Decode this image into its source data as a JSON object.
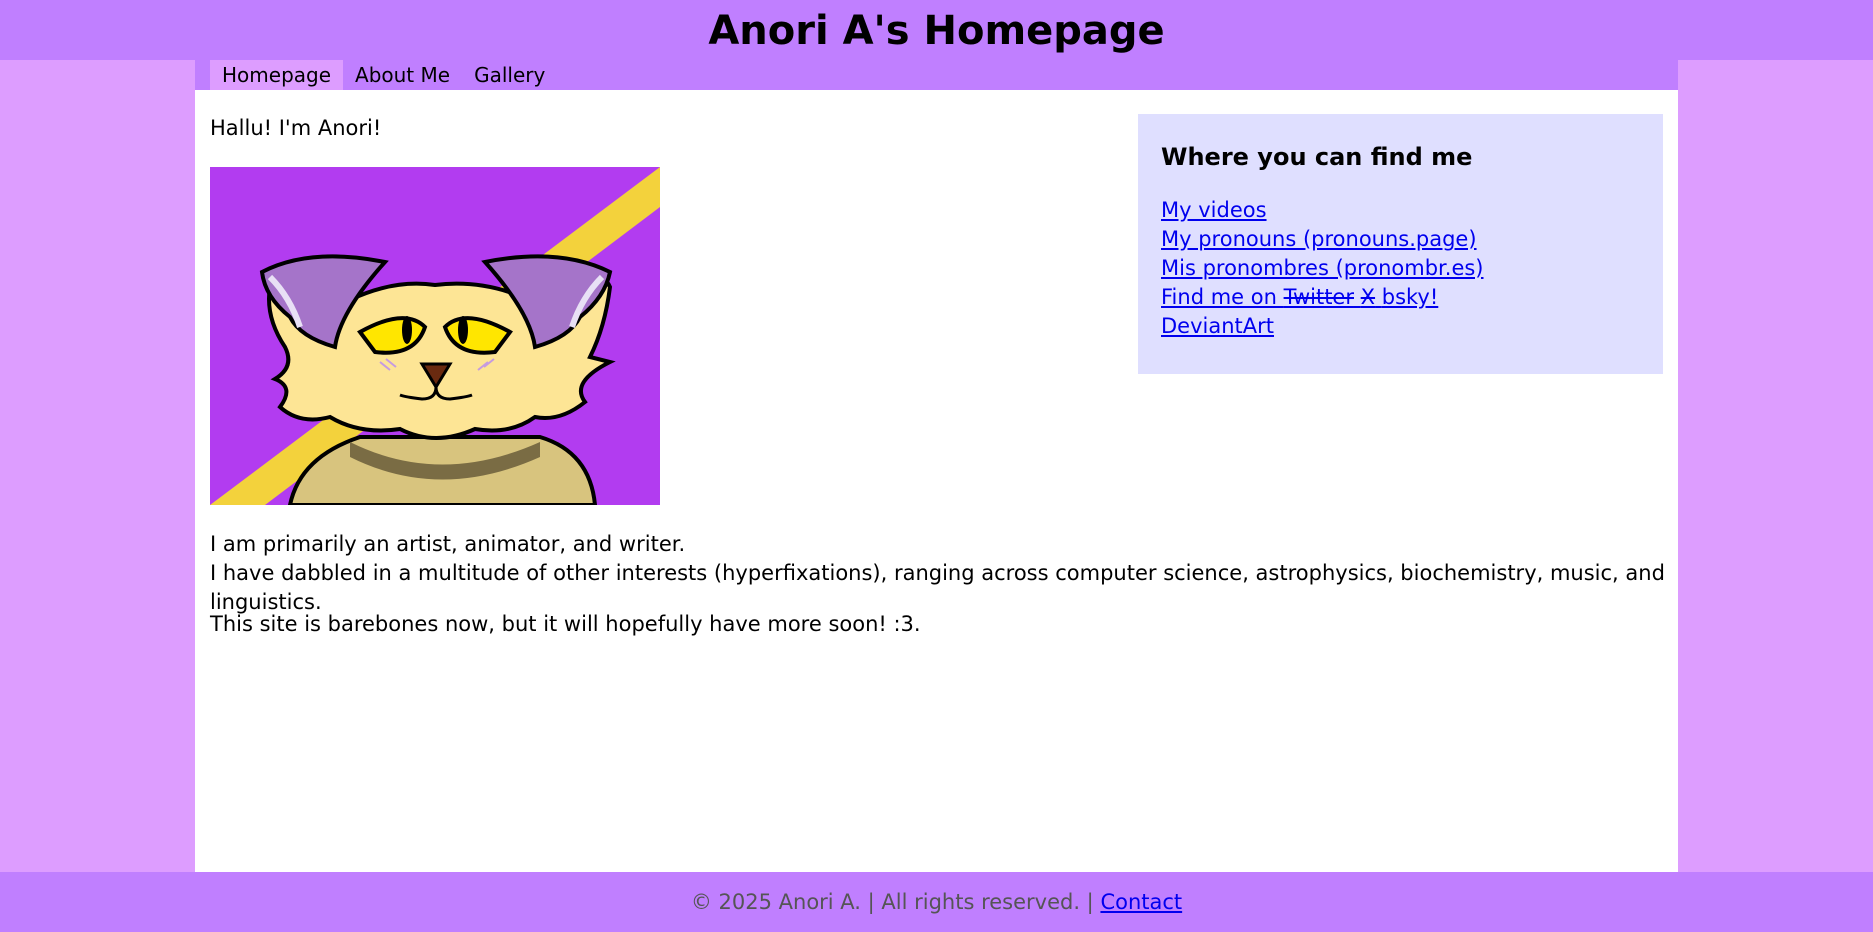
{
  "header": {
    "title": "Anori A's Homepage"
  },
  "nav": {
    "items": [
      {
        "label": "Homepage",
        "active": true
      },
      {
        "label": "About Me"
      },
      {
        "label": "Gallery"
      }
    ]
  },
  "main": {
    "greeting": "Hallu! I'm Anori!",
    "bio_line_1": "I am primarily an artist, animator, and writer.",
    "bio_line_2": "I have dabbled in a multitude of other interests (hyperfixations), ranging across computer science, astrophysics, biochemistry, music, and linguistics.",
    "closing": "This site is barebones now, but it will hopefully have more soon! :3."
  },
  "sidebar": {
    "title": "Where you can find me",
    "links": {
      "videos": "My videos",
      "pronouns": "My pronouns (pronouns.page)",
      "pronombres": "Mis pronombres (pronombr.es)",
      "social_prefix": "Find me on ",
      "social_struck_1": "Twitter",
      "social_struck_2": "X",
      "social_current": "bsky!",
      "deviantart": "DeviantArt"
    }
  },
  "footer": {
    "text": "© 2025 Anori A. | All rights reserved. | ",
    "contact": "Contact"
  },
  "colors": {
    "header_bg": "#c07fff",
    "page_bg": "#dd9dff",
    "sidebar_bg": "#dfdfff",
    "link": "#0000ee",
    "avatar_bg": "#b23cf0",
    "avatar_stripe": "#f3d23c"
  }
}
